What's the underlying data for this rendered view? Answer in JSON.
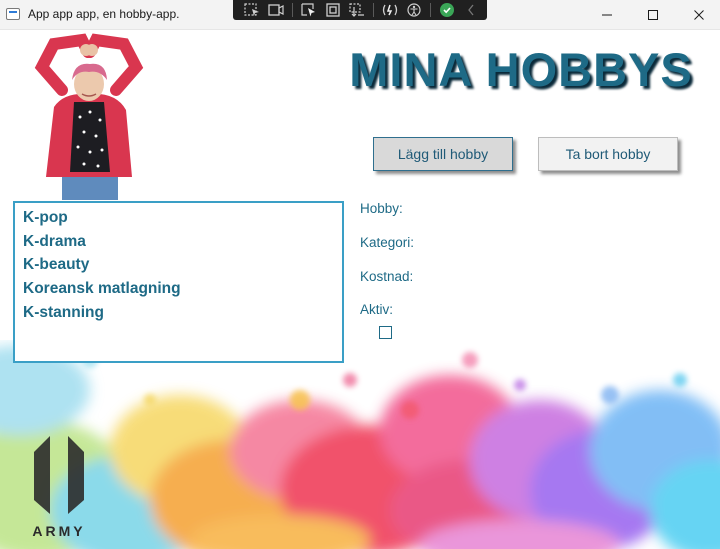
{
  "window": {
    "title": "App app app, en hobby-app.",
    "controls": [
      "minimize",
      "maximize",
      "close"
    ]
  },
  "debug_toolbar": {
    "icons": [
      "live-visual-tree-icon",
      "select-element-icon",
      "display-adorners-icon",
      "track-focus-icon",
      "hot-reload-icon",
      "accessibility-icon",
      "status-check-icon",
      "collapse-chevron-icon"
    ]
  },
  "header": {
    "heading": "MINA HOBBYS"
  },
  "buttons": {
    "add_label": "Lägg till hobby",
    "remove_label": "Ta bort hobby"
  },
  "hobby_list": {
    "items": [
      "K-pop",
      "K-drama",
      "K-beauty",
      "Koreansk matlagning",
      "K-stanning"
    ]
  },
  "details": {
    "hobby_label": "Hobby:",
    "category_label": "Kategori:",
    "cost_label": "Kostnad:",
    "active_label": "Aktiv:",
    "active_checked": false
  },
  "logo": {
    "text": "ARMY"
  },
  "colors": {
    "accent": "#1e6a86",
    "list_border": "#3a9fc6",
    "titlebar_bg": "#f3f3f3"
  }
}
